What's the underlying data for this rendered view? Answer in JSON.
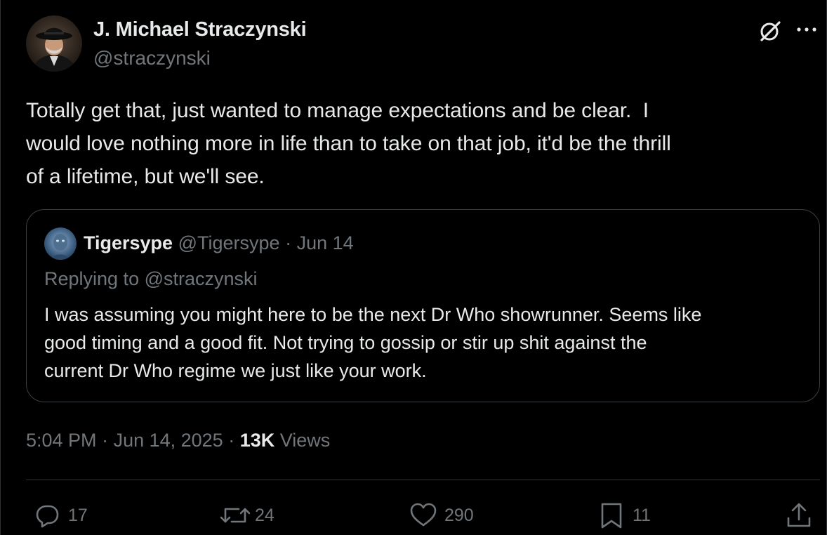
{
  "author": {
    "name": "J. Michael Straczynski",
    "handle": "@straczynski"
  },
  "tweet": {
    "text": "Totally get that, just wanted to manage expectations and be clear.  I\nwould love nothing more in life than to take on that job, it'd be the thrill\nof a lifetime, but we'll see."
  },
  "quote": {
    "name": "Tigersype",
    "handle": "@Tigersype",
    "separator": " · ",
    "date": "Jun 14",
    "reply_context": "Replying to @straczynski",
    "text": "I was assuming you might here to be the next Dr Who showrunner. Seems like\ngood timing and a good fit. Not trying to gossip or stir up shit against the\ncurrent Dr Who regime we just like your work."
  },
  "meta": {
    "time": "5:04 PM",
    "separator": " · ",
    "date": "Jun 14, 2025",
    "views_count": "13K",
    "views_label": " Views"
  },
  "actions": {
    "replies": "17",
    "reposts": "24",
    "likes": "290",
    "bookmarks": "11"
  },
  "icons": {
    "header": [
      "grok-icon",
      "more-icon"
    ],
    "actions": [
      "reply-icon",
      "repost-icon",
      "like-icon",
      "bookmark-icon",
      "share-icon"
    ]
  },
  "colors": {
    "background": "#000000",
    "text_primary": "#e7e9ea",
    "text_secondary": "#71767b",
    "border": "#2f3336"
  }
}
